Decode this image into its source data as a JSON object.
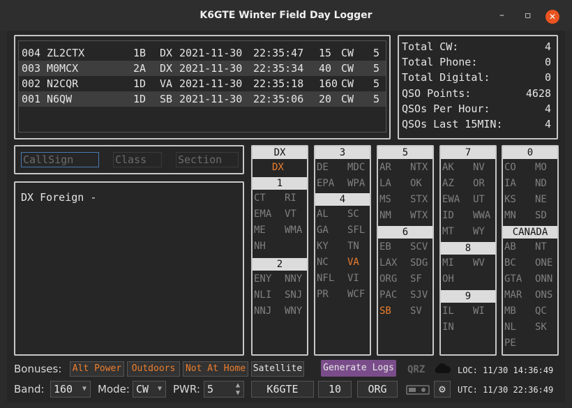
{
  "window": {
    "title": "K6GTE Winter Field Day Logger",
    "minimize": "–",
    "maximize": "▫",
    "close": "✕"
  },
  "log": [
    {
      "num": "004",
      "call": "ZL2CTX",
      "cls": "1B",
      "sec": "DX",
      "date": "2021-11-30",
      "time": "22:35:47",
      "band": "15",
      "mode": "CW",
      "power": "5"
    },
    {
      "num": "003",
      "call": "M0MCX",
      "cls": "2A",
      "sec": "DX",
      "date": "2021-11-30",
      "time": "22:35:34",
      "band": "40",
      "mode": "CW",
      "power": "5"
    },
    {
      "num": "002",
      "call": "N2CQR",
      "cls": "1D",
      "sec": "VA",
      "date": "2021-11-30",
      "time": "22:35:18",
      "band": "160",
      "mode": "CW",
      "power": "5"
    },
    {
      "num": "001",
      "call": "N6QW",
      "cls": "1D",
      "sec": "SB",
      "date": "2021-11-30",
      "time": "22:35:06",
      "band": "20",
      "mode": "CW",
      "power": "5"
    }
  ],
  "stats": [
    {
      "label": "Total CW:",
      "value": "4"
    },
    {
      "label": "Total Phone:",
      "value": "0"
    },
    {
      "label": "Total Digital:",
      "value": "0"
    },
    {
      "label": "QSO Points:",
      "value": "4628"
    },
    {
      "label": "QSOs Per Hour:",
      "value": "4"
    },
    {
      "label": "QSOs Last 15MIN:",
      "value": "4"
    }
  ],
  "entry": {
    "callsign_ph": "CallSign",
    "class_ph": "Class",
    "section_ph": "Section"
  },
  "info": {
    "text": "DX Foreign -"
  },
  "sections": {
    "dx_header": "DX",
    "dx": "DX",
    "h1": "1",
    "s1": [
      "CT",
      "RI",
      "EMA",
      "VT",
      "ME",
      "WMA",
      "NH"
    ],
    "h2": "2",
    "s2": [
      "ENY",
      "NNY",
      "NLI",
      "SNJ",
      "NNJ",
      "WNY"
    ],
    "h3": "3",
    "s3": [
      "DE",
      "MDC",
      "EPA",
      "WPA"
    ],
    "h4": "4",
    "s4": [
      "AL",
      "SC",
      "GA",
      "SFL",
      "KY",
      "TN",
      "NC",
      "VA",
      "NFL",
      "VI",
      "PR",
      "WCF"
    ],
    "h5": "5",
    "s5": [
      "AR",
      "NTX",
      "LA",
      "OK",
      "MS",
      "STX",
      "NM",
      "WTX"
    ],
    "h6": "6",
    "s6": [
      "EB",
      "SCV",
      "LAX",
      "SDG",
      "ORG",
      "SF",
      "PAC",
      "SJV",
      "SB",
      "SV"
    ],
    "h7": "7",
    "s7": [
      "AK",
      "NV",
      "AZ",
      "OR",
      "EWA",
      "UT",
      "ID",
      "WWA",
      "MT",
      "WY"
    ],
    "h8": "8",
    "s8": [
      "MI",
      "WV",
      "OH"
    ],
    "h9": "9",
    "s9": [
      "IL",
      "WI",
      "IN"
    ],
    "h0": "0",
    "s0": [
      "CO",
      "MO",
      "IA",
      "ND",
      "KS",
      "NE",
      "MN",
      "SD"
    ],
    "hca": "CANADA",
    "sca": [
      "AB",
      "NT",
      "BC",
      "ONE",
      "GTA",
      "ONN",
      "MAR",
      "ONS",
      "MB",
      "QC",
      "NL",
      "SK",
      "PE"
    ],
    "worked": [
      "DX",
      "VA",
      "SB"
    ]
  },
  "bottom": {
    "bonuses_label": "Bonuses:",
    "bonuses": [
      "Alt Power",
      "Outdoors",
      "Not At Home",
      "Satellite"
    ],
    "generate_logs": "Generate Logs",
    "qrz": "QRZ",
    "loc_time": "LOC: 11/30 14:36:49",
    "utc_time": "UTC: 11/30 22:36:49",
    "band_label": "Band:",
    "band": "160",
    "mode_label": "Mode:",
    "mode": "CW",
    "pwr_label": "PWR:",
    "pwr": "5",
    "callsign": "K6GTE",
    "class_num": "10",
    "section": "ORG"
  },
  "colors": {
    "accent": "#ee7f2d",
    "close": "#e95420",
    "generate": "#7a4d8a"
  }
}
